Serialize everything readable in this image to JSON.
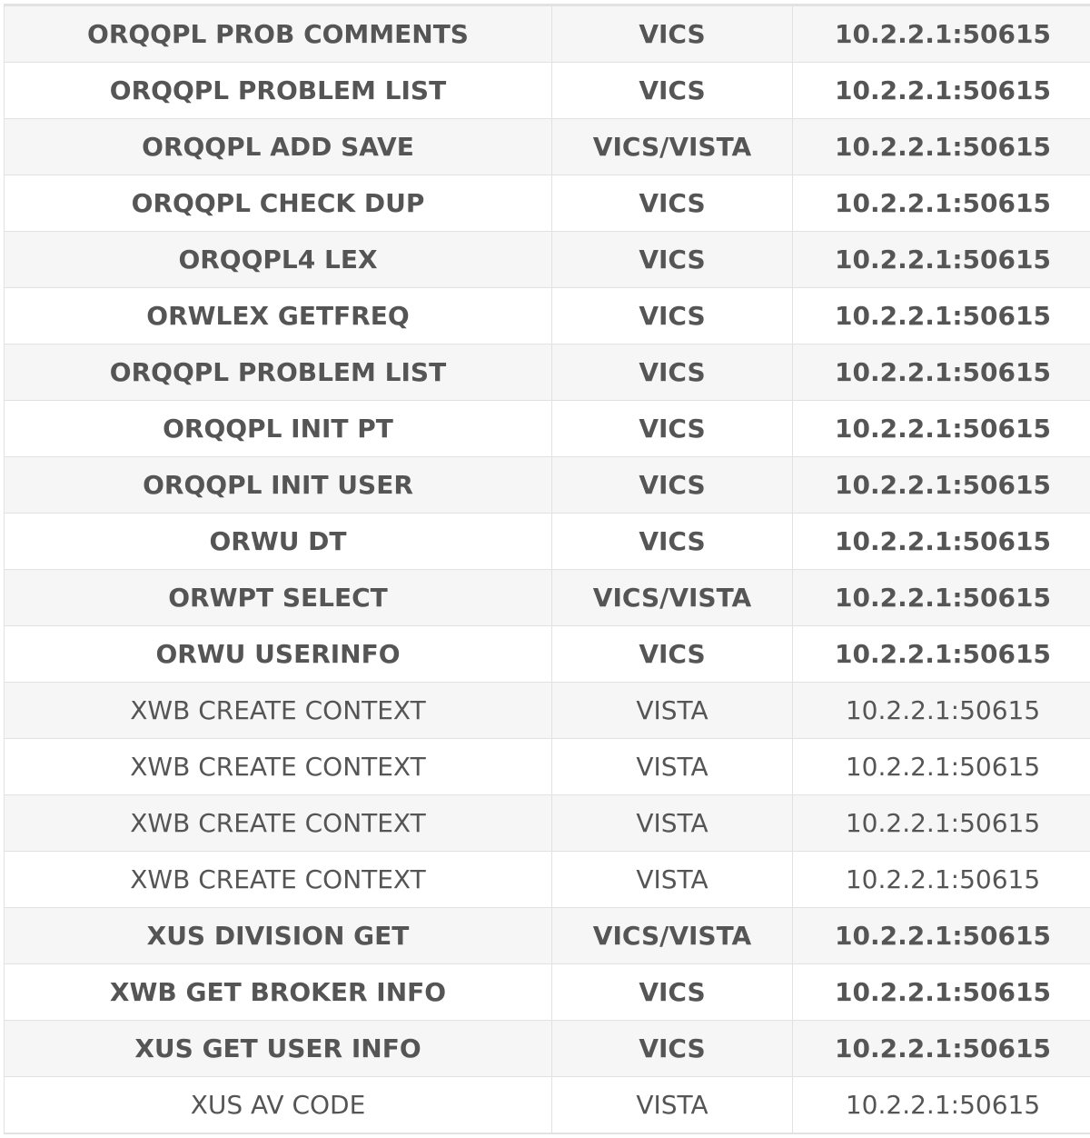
{
  "rows": [
    {
      "rpc": "ORQQPL PROB COMMENTS",
      "source": "VICS",
      "address": "10.2.2.1:50615",
      "bold": true
    },
    {
      "rpc": "ORQQPL PROBLEM LIST",
      "source": "VICS",
      "address": "10.2.2.1:50615",
      "bold": true
    },
    {
      "rpc": "ORQQPL ADD SAVE",
      "source": "VICS/VISTA",
      "address": "10.2.2.1:50615",
      "bold": true
    },
    {
      "rpc": "ORQQPL CHECK DUP",
      "source": "VICS",
      "address": "10.2.2.1:50615",
      "bold": true
    },
    {
      "rpc": "ORQQPL4 LEX",
      "source": "VICS",
      "address": "10.2.2.1:50615",
      "bold": true
    },
    {
      "rpc": "ORWLEX GETFREQ",
      "source": "VICS",
      "address": "10.2.2.1:50615",
      "bold": true
    },
    {
      "rpc": "ORQQPL PROBLEM LIST",
      "source": "VICS",
      "address": "10.2.2.1:50615",
      "bold": true
    },
    {
      "rpc": "ORQQPL INIT PT",
      "source": "VICS",
      "address": "10.2.2.1:50615",
      "bold": true
    },
    {
      "rpc": "ORQQPL INIT USER",
      "source": "VICS",
      "address": "10.2.2.1:50615",
      "bold": true
    },
    {
      "rpc": "ORWU DT",
      "source": "VICS",
      "address": "10.2.2.1:50615",
      "bold": true
    },
    {
      "rpc": "ORWPT SELECT",
      "source": "VICS/VISTA",
      "address": "10.2.2.1:50615",
      "bold": true
    },
    {
      "rpc": "ORWU USERINFO",
      "source": "VICS",
      "address": "10.2.2.1:50615",
      "bold": true
    },
    {
      "rpc": "XWB CREATE CONTEXT",
      "source": "VISTA",
      "address": "10.2.2.1:50615",
      "bold": false
    },
    {
      "rpc": "XWB CREATE CONTEXT",
      "source": "VISTA",
      "address": "10.2.2.1:50615",
      "bold": false
    },
    {
      "rpc": "XWB CREATE CONTEXT",
      "source": "VISTA",
      "address": "10.2.2.1:50615",
      "bold": false
    },
    {
      "rpc": "XWB CREATE CONTEXT",
      "source": "VISTA",
      "address": "10.2.2.1:50615",
      "bold": false
    },
    {
      "rpc": "XUS DIVISION GET",
      "source": "VICS/VISTA",
      "address": "10.2.2.1:50615",
      "bold": true
    },
    {
      "rpc": "XWB GET BROKER INFO",
      "source": "VICS",
      "address": "10.2.2.1:50615",
      "bold": true
    },
    {
      "rpc": "XUS GET USER INFO",
      "source": "VICS",
      "address": "10.2.2.1:50615",
      "bold": true
    },
    {
      "rpc": "XUS AV CODE",
      "source": "VISTA",
      "address": "10.2.2.1:50615",
      "bold": false
    }
  ],
  "colors": {
    "text": "#555555",
    "border": "#e2e2e2",
    "shaded_row": "#f6f6f6",
    "background": "#ffffff"
  }
}
